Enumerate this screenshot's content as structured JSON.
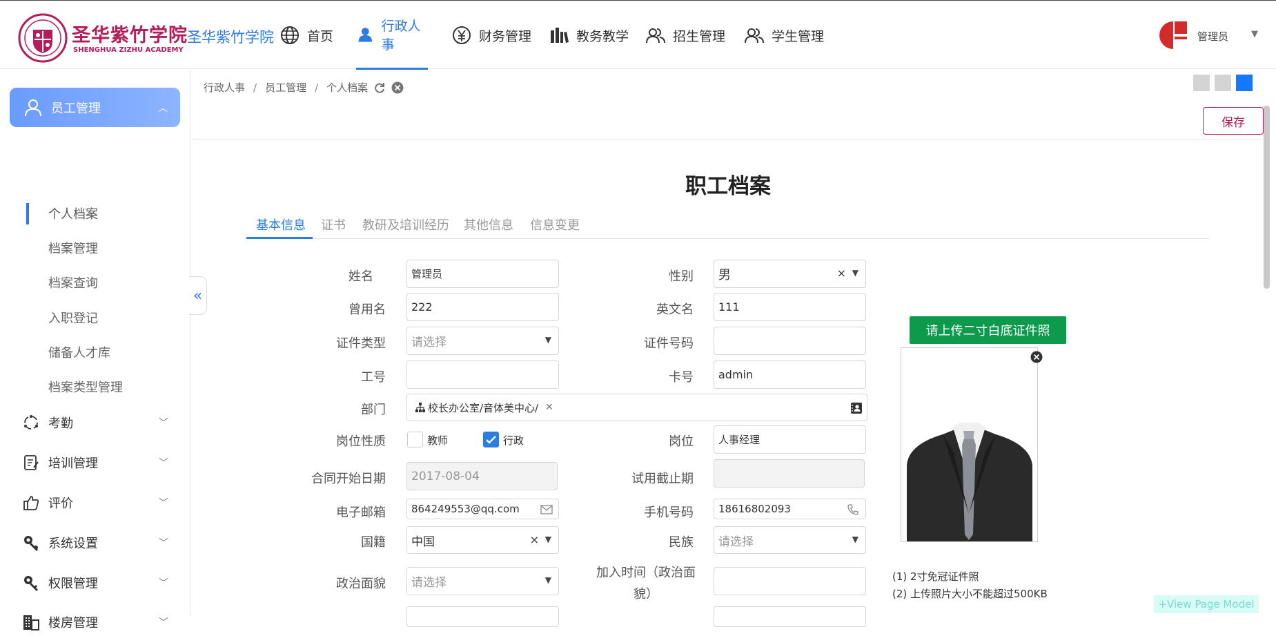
{
  "header": {
    "logo_cn": "圣华紫竹学院",
    "logo_en": "SHENGHUA ZIZHU ACADEMY",
    "site_name": "圣华紫竹学院",
    "nav": [
      {
        "label": "首页",
        "icon": "globe-icon"
      },
      {
        "label": "行政人事",
        "icon": "user-icon",
        "active": true
      },
      {
        "label": "财务管理",
        "icon": "yen-icon"
      },
      {
        "label": "教务教学",
        "icon": "books-icon"
      },
      {
        "label": "招生管理",
        "icon": "users-icon"
      },
      {
        "label": "学生管理",
        "icon": "users-icon"
      }
    ],
    "user_name": "管理员",
    "accent": "#2d7de0",
    "brand": "#b31d5a"
  },
  "sidebar": {
    "group": "员工管理",
    "sub_items": [
      "个人档案",
      "档案管理",
      "档案查询",
      "入职登记",
      "储备人才库",
      "档案类型管理"
    ],
    "items": [
      {
        "label": "考勤",
        "icon": "attendance-icon"
      },
      {
        "label": "培训管理",
        "icon": "training-icon"
      },
      {
        "label": "评价",
        "icon": "thumbs-up-icon"
      },
      {
        "label": "系统设置",
        "icon": "settings-icon"
      },
      {
        "label": "权限管理",
        "icon": "permission-icon"
      },
      {
        "label": "楼房管理",
        "icon": "building-icon"
      }
    ]
  },
  "breadcrumb": [
    "行政人事",
    "员工管理",
    "个人档案"
  ],
  "toolbar": {
    "save_label": "保存"
  },
  "doc_title": "职工档案",
  "tabs": [
    "基本信息",
    "证书",
    "教研及培训经历",
    "其他信息",
    "信息变更"
  ],
  "form": {
    "name": {
      "label": "姓名",
      "value": "管理员"
    },
    "gender": {
      "label": "性别",
      "value": "男"
    },
    "former_name": {
      "label": "曾用名",
      "value": "222"
    },
    "english_name": {
      "label": "英文名",
      "value": "111"
    },
    "id_type": {
      "label": "证件类型",
      "placeholder": "请选择"
    },
    "id_number": {
      "label": "证件号码",
      "value": ""
    },
    "staff_no": {
      "label": "工号",
      "value": ""
    },
    "card_no": {
      "label": "卡号",
      "value": "admin"
    },
    "department": {
      "label": "部门",
      "value": "校长办公室/音体美中心/"
    },
    "post_type": {
      "label": "岗位性质",
      "options": [
        {
          "label": "教师",
          "checked": false
        },
        {
          "label": "行政",
          "checked": true
        }
      ]
    },
    "position": {
      "label": "岗位",
      "value": "人事经理"
    },
    "contract_start": {
      "label": "合同开始日期",
      "value": "2017-08-04"
    },
    "probation_end": {
      "label": "试用截止期",
      "value": ""
    },
    "email": {
      "label": "电子邮箱",
      "value": "864249553@qq.com"
    },
    "phone": {
      "label": "手机号码",
      "value": "18616802093"
    },
    "nationality": {
      "label": "国籍",
      "value": "中国"
    },
    "ethnicity": {
      "label": "民族",
      "placeholder": "请选择"
    },
    "political_status": {
      "label": "政治面貌",
      "placeholder": "请选择"
    },
    "join_time": {
      "label_line1": "加入时间（政治面",
      "label_line2": "貌）",
      "value": ""
    }
  },
  "photo": {
    "upload_label": "请上传二寸白底证件照",
    "notes": [
      "(1)  2寸免冠证件照",
      "(2)  上传照片大小不能超过500KB"
    ]
  },
  "watermark": "+View Page Model"
}
